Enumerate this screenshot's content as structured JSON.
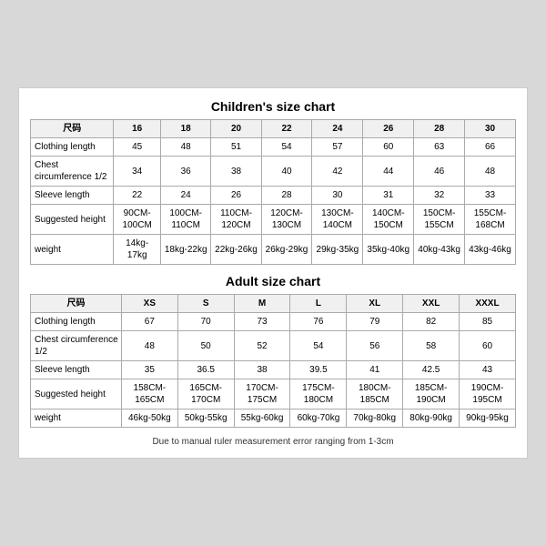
{
  "children_title": "Children's size chart",
  "adult_title": "Adult size chart",
  "footnote": "Due to manual ruler measurement error ranging from 1-3cm",
  "children": {
    "headers": [
      "尺码",
      "16",
      "18",
      "20",
      "22",
      "24",
      "26",
      "28",
      "30"
    ],
    "rows": [
      {
        "label": "Clothing length",
        "values": [
          "45",
          "48",
          "51",
          "54",
          "57",
          "60",
          "63",
          "66"
        ]
      },
      {
        "label": "Chest circumference 1/2",
        "values": [
          "34",
          "36",
          "38",
          "40",
          "42",
          "44",
          "46",
          "48"
        ]
      },
      {
        "label": "Sleeve length",
        "values": [
          "22",
          "24",
          "26",
          "28",
          "30",
          "31",
          "32",
          "33"
        ]
      },
      {
        "label": "Suggested height",
        "values": [
          "90CM-100CM",
          "100CM-110CM",
          "110CM-120CM",
          "120CM-130CM",
          "130CM-140CM",
          "140CM-150CM",
          "150CM-155CM",
          "155CM-168CM"
        ]
      },
      {
        "label": "weight",
        "values": [
          "14kg-17kg",
          "18kg-22kg",
          "22kg-26kg",
          "26kg-29kg",
          "29kg-35kg",
          "35kg-40kg",
          "40kg-43kg",
          "43kg-46kg"
        ]
      }
    ]
  },
  "adult": {
    "headers": [
      "尺码",
      "XS",
      "S",
      "M",
      "L",
      "XL",
      "XXL",
      "XXXL"
    ],
    "rows": [
      {
        "label": "Clothing length",
        "values": [
          "67",
          "70",
          "73",
          "76",
          "79",
          "82",
          "85"
        ]
      },
      {
        "label": "Chest circumference 1/2",
        "values": [
          "48",
          "50",
          "52",
          "54",
          "56",
          "58",
          "60"
        ]
      },
      {
        "label": "Sleeve length",
        "values": [
          "35",
          "36.5",
          "38",
          "39.5",
          "41",
          "42.5",
          "43"
        ]
      },
      {
        "label": "Suggested height",
        "values": [
          "158CM-165CM",
          "165CM-170CM",
          "170CM-175CM",
          "175CM-180CM",
          "180CM-185CM",
          "185CM-190CM",
          "190CM-195CM"
        ]
      },
      {
        "label": "weight",
        "values": [
          "46kg-50kg",
          "50kg-55kg",
          "55kg-60kg",
          "60kg-70kg",
          "70kg-80kg",
          "80kg-90kg",
          "90kg-95kg"
        ]
      }
    ]
  }
}
